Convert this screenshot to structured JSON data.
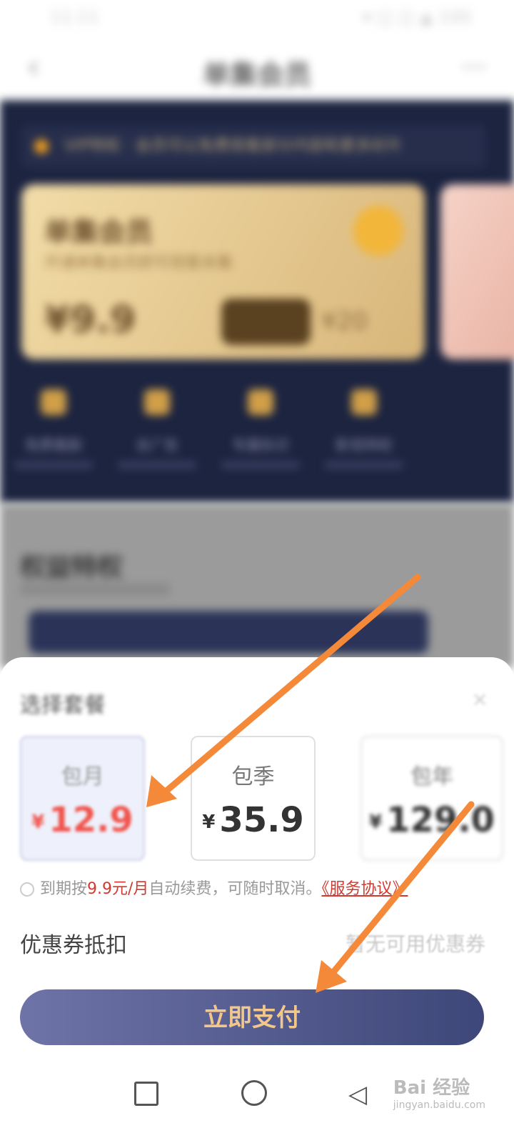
{
  "status_bar": {
    "time": "11:11",
    "right": "▾ ◫ ◫ ▲ 100"
  },
  "nav": {
    "back": "‹",
    "title": "单集会员",
    "more": "···"
  },
  "background": {
    "notice": "VIP特权 · 会员可以免费观看部分内容和更多好片",
    "vip_card": {
      "name": "单集会员",
      "sub": "开通单集会员即可观看本集",
      "price": "¥9.9",
      "original": "¥20",
      "perk_labels": [
        "免费看剧",
        "去广告",
        "专属标识",
        "影视特权"
      ]
    },
    "section_title": "权益特权"
  },
  "sheet": {
    "title": "选择套餐",
    "close": "×",
    "plans": [
      {
        "name": "包月",
        "currency": "¥",
        "price": "12.9"
      },
      {
        "name": "包季",
        "currency": "¥",
        "price": "35.9"
      },
      {
        "name": "包年",
        "currency": "¥",
        "price": "129.0"
      }
    ],
    "renew": {
      "prefix": "到期按",
      "price": "9.9元/月",
      "suffix": "自动续费，可随时取消。",
      "link": "《服务协议》"
    },
    "coupon_label": "优惠券抵扣",
    "coupon_value": "暂无可用优惠券",
    "pay_button": "立即支付"
  },
  "watermark": {
    "brand": "Bai 经验",
    "url": "jingyan.baidu.com"
  },
  "colors": {
    "accent_red": "#f0554e",
    "button_start": "#6e73a8",
    "button_end": "#3e4779",
    "button_text": "#f3c78a",
    "arrow": "#f5893a"
  }
}
